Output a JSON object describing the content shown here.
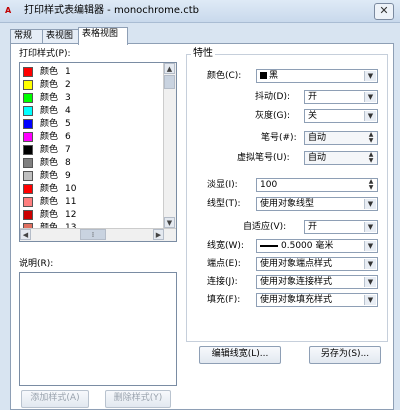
{
  "window": {
    "title": "打印样式表编辑器 - monochrome.ctb",
    "app_icon": "A",
    "close_glyph": "✕"
  },
  "tabs": [
    {
      "label": "常规"
    },
    {
      "label": "表视图"
    },
    {
      "label": "表格视图"
    }
  ],
  "left": {
    "styles_label": "打印样式(P):",
    "items": [
      {
        "name": "颜色",
        "num": "1",
        "color": "#ff0000"
      },
      {
        "name": "颜色",
        "num": "2",
        "color": "#ffff00"
      },
      {
        "name": "颜色",
        "num": "3",
        "color": "#00ff00"
      },
      {
        "name": "颜色",
        "num": "4",
        "color": "#00ffff"
      },
      {
        "name": "颜色",
        "num": "5",
        "color": "#0000ff"
      },
      {
        "name": "颜色",
        "num": "6",
        "color": "#ff00ff"
      },
      {
        "name": "颜色",
        "num": "7",
        "color": "#000000"
      },
      {
        "name": "颜色",
        "num": "8",
        "color": "#808080"
      },
      {
        "name": "颜色",
        "num": "9",
        "color": "#c0c0c0"
      },
      {
        "name": "颜色",
        "num": "10",
        "color": "#ff0000"
      },
      {
        "name": "颜色",
        "num": "11",
        "color": "#ff7f7f"
      },
      {
        "name": "颜色",
        "num": "12",
        "color": "#cc0000"
      },
      {
        "name": "颜色",
        "num": "13",
        "color": "#e07060"
      }
    ],
    "description_label": "说明(R):",
    "add_style_button": "添加样式(A)",
    "delete_style_button": "删除样式(Y)"
  },
  "properties": {
    "group_title": "特性",
    "color_label": "颜色(C):",
    "color_value": "黑",
    "dither_label": "抖动(D):",
    "dither_value": "开",
    "grayscale_label": "灰度(G):",
    "grayscale_value": "关",
    "pen_label": "笔号(#):",
    "pen_value": "自动",
    "virtual_pen_label": "虚拟笔号(U):",
    "virtual_pen_value": "自动",
    "screening_label": "淡显(I):",
    "screening_value": "100",
    "linetype_label": "线型(T):",
    "linetype_value": "使用对象线型",
    "adaptive_label": "自适应(V):",
    "adaptive_value": "开",
    "lineweight_label": "线宽(W):",
    "lineweight_value": "0.5000 毫米",
    "endstyle_label": "端点(E):",
    "endstyle_value": "使用对象端点样式",
    "joinstyle_label": "连接(J):",
    "joinstyle_value": "使用对象连接样式",
    "fill_label": "填充(F):",
    "fill_value": "使用对象填充样式",
    "edit_lineweights_button": "编辑线宽(L)...",
    "save_as_button": "另存为(S)..."
  },
  "icons": {
    "dropdown": "chevron-down-icon",
    "spinner": "spin-icon"
  }
}
